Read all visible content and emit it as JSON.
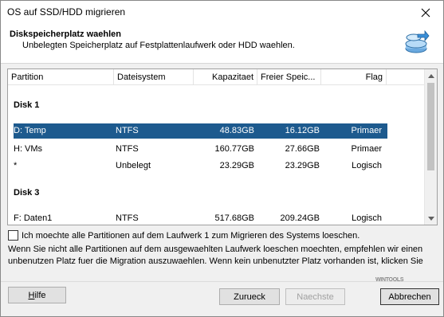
{
  "window": {
    "title": "OS auf SSD/HDD migrieren"
  },
  "header": {
    "title": "Diskspeicherplatz waehlen",
    "subtitle": "Unbelegten Speicherplatz auf Festplattenlaufwerk oder HDD waehlen.",
    "icon": "disk-migrate-icon"
  },
  "table": {
    "columns": [
      "Partition",
      "Dateisystem",
      "Kapazitaet",
      "Freier Speic...",
      "Flag"
    ],
    "groups": [
      {
        "label": "Disk 1",
        "rows": [
          {
            "partition": "D:  Temp",
            "fs": "NTFS",
            "capacity": "48.83GB",
            "free": "16.12GB",
            "flag": "Primaer",
            "selected": true
          },
          {
            "partition": "H:  VMs",
            "fs": "NTFS",
            "capacity": "160.77GB",
            "free": "27.66GB",
            "flag": "Primaer",
            "selected": false
          },
          {
            "partition": "*",
            "fs": "Unbelegt",
            "capacity": "23.29GB",
            "free": "23.29GB",
            "flag": "Logisch",
            "selected": false
          }
        ]
      },
      {
        "label": "Disk 3",
        "rows": [
          {
            "partition": "F:  Daten1",
            "fs": "NTFS",
            "capacity": "517.68GB",
            "free": "209.24GB",
            "flag": "Logisch",
            "selected": false
          }
        ]
      }
    ]
  },
  "checkbox": {
    "label": "Ich moechte alle Partitionen auf dem Laufwerk 1 zum Migrieren des Systems loeschen.",
    "checked": false
  },
  "info": {
    "line1": "Wenn Sie nicht alle Partitionen auf dem ausgewaehlten Laufwerk loeschen moechten, empfehlen wir einen",
    "line2": "unbenutzen Platz fuer die Migration auszuwaehlen. Wenn kein unbenutzter Platz vorhanden ist, klicken Sie"
  },
  "buttons": {
    "help": {
      "underlined": "H",
      "rest": "ilfe"
    },
    "back": "Zurueck",
    "next": "Naechste",
    "cancel": "Abbrechen"
  },
  "branding": "WINTOOLS",
  "colors": {
    "selection": "#1d5a8e",
    "icon_blue": "#3a8fd8"
  }
}
